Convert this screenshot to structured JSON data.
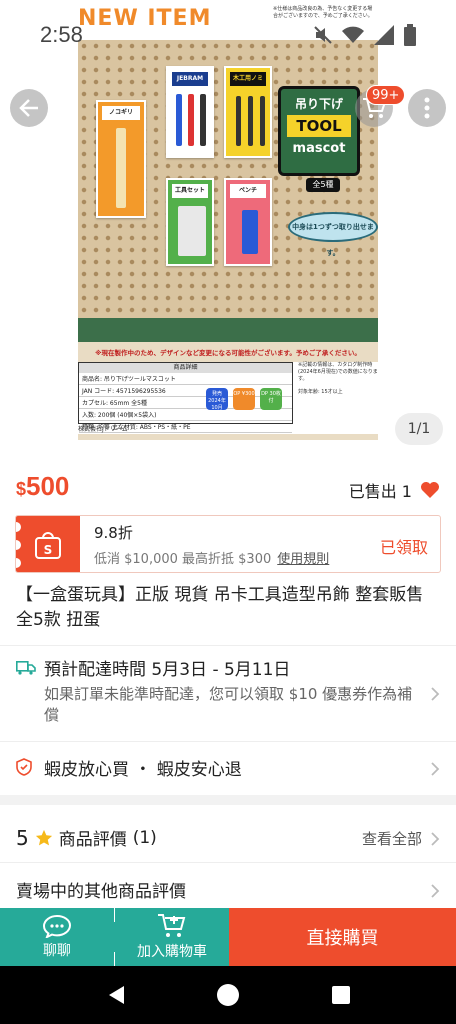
{
  "status_bar": {
    "time": "2:58"
  },
  "hero": {
    "new_item": "NEW ITEM",
    "note": "※仕様は商品改良の為、予告なく変更する場合がございますので、予めご了承ください。",
    "cards": [
      {
        "label": "ノコギリ"
      },
      {
        "label": "JEBRAM TOOL SET"
      },
      {
        "label": "木工用ノミ 3本組"
      },
      {
        "label": "工具セット"
      },
      {
        "label": "ペンチ"
      }
    ],
    "logo_line1": "吊り下げ",
    "logo_line2": "TOOL",
    "logo_line3": "mascot",
    "badge": "全5種",
    "bubble": "中身は1つずつ取り出せます。",
    "warning": "※現在製作中のため、デザインなど変更になる可能性がございます。予めご了承ください。",
    "spec_title": "商品詳細",
    "spec_rows": [
      "商品名: 吊り下げツールマスコット",
      "JAN コード: 4571596295536",
      "カプセル: 65mm    全5種",
      "入数: 200個 (40個×5袋入)",
      "種類: 均等  主な材質: ABS・PS・紙・PE"
    ],
    "release": "発売 2024年 10月",
    "price_tag": "OP ¥300",
    "dp_tag": "DP 30枚付",
    "side_note": "※記載の情報は、カタログ制作時(2024年6月現在)での数値になります。",
    "age": "対象年齢: 15才以上",
    "company": "株式会社Jドリーム"
  },
  "header_buttons": {
    "cart_badge": "99+"
  },
  "image_counter": "1/1",
  "price": {
    "currency": "$",
    "amount": "500"
  },
  "sold": "已售出 1",
  "voucher": {
    "title": "9.8折",
    "sub": "低消 $10,000 最高折抵 $300",
    "rules": "使用規則",
    "status": "已領取"
  },
  "product_title": "【一盒蛋玩具】正版 現貨 吊卡工具造型吊飾 整套販售 全5款 扭蛋",
  "shipping": {
    "main": "預計配達時間 5月3日 - 5月11日",
    "sub": "如果訂單未能準時配達，您可以領取 $10 優惠券作為補償"
  },
  "guarantee": "蝦皮放心買 ・ 蝦皮安心退",
  "ratings": {
    "score": "5",
    "label": "商品評價",
    "count": "(1)",
    "see_all": "查看全部"
  },
  "other_reviews": "賣場中的其他商品評價",
  "bottom_bar": {
    "chat": "聊聊",
    "add_cart": "加入購物車",
    "buy": "直接購買"
  },
  "colors": {
    "accent": "#ee4d2d",
    "teal": "#26aa99"
  }
}
